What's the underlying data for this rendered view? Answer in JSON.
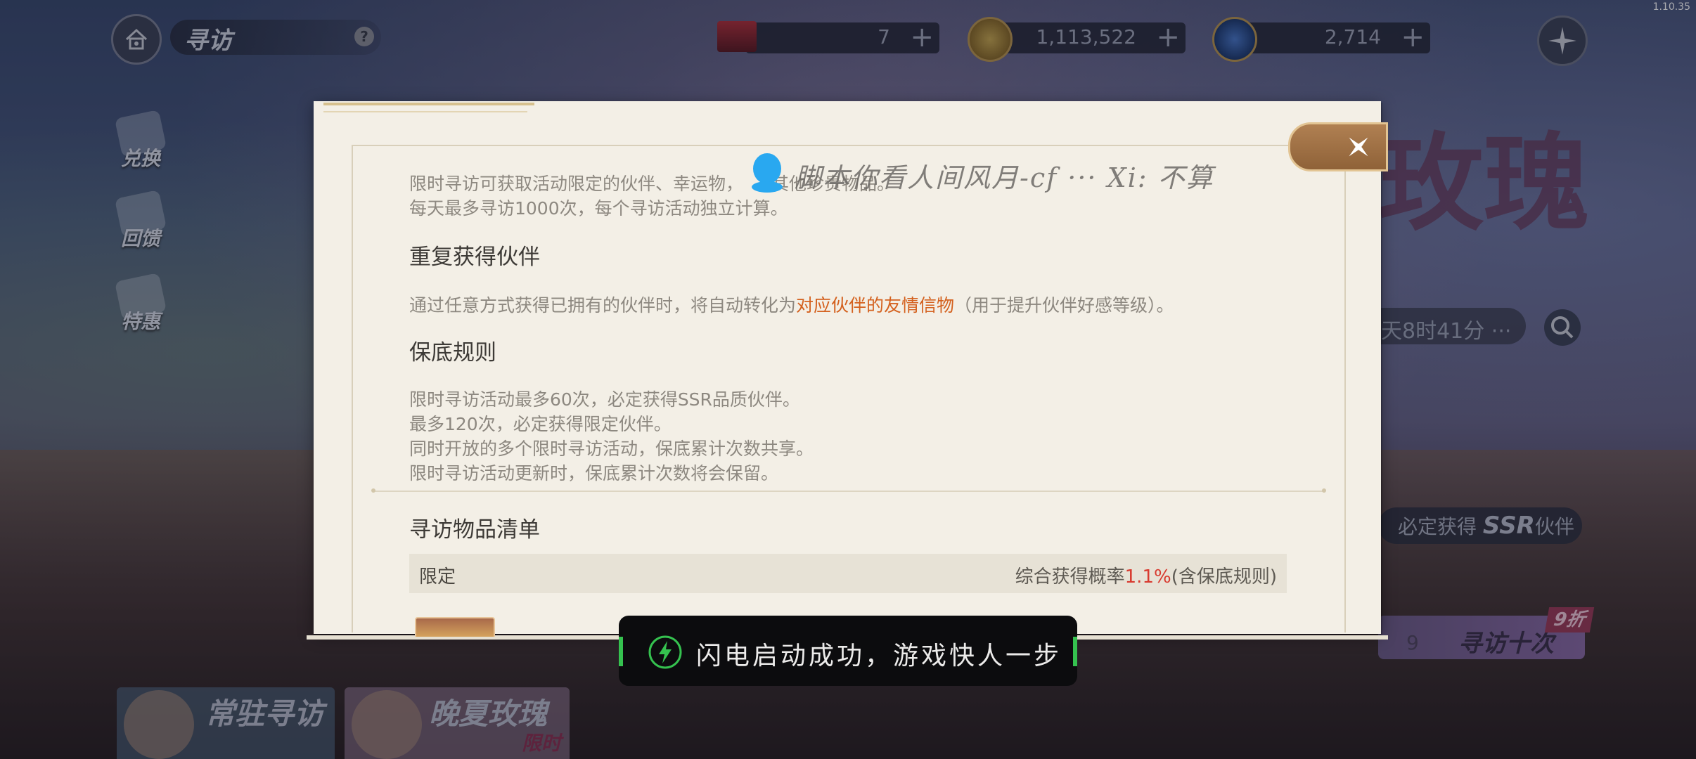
{
  "version": "1.10.35",
  "hud": {
    "title": "寻访",
    "help_label": "?",
    "resources": [
      {
        "icon": "ticket-icon",
        "value": "7",
        "add_label": "+"
      },
      {
        "icon": "gold-coin-icon",
        "value": "1,113,522",
        "add_label": "+"
      },
      {
        "icon": "gem-orb-icon",
        "value": "2,714",
        "add_label": "+"
      }
    ]
  },
  "side_menu": [
    {
      "icon": "scroll-icon",
      "label": "兑换"
    },
    {
      "icon": "gift-icon",
      "label": "回馈"
    },
    {
      "icon": "ticket-tag-icon",
      "label": "特惠"
    }
  ],
  "background": {
    "banner_title": "玫瑰",
    "timer_text": "天8时41分 ···",
    "guarantee_prefix": "必定获得",
    "guarantee_tier": "SSR",
    "guarantee_suffix": "伙伴",
    "ten_pull_count": "9",
    "ten_pull_label": "寻访十次",
    "discount_badge": "9折"
  },
  "bottom_tabs": [
    {
      "label": "常驻寻访",
      "tag": ""
    },
    {
      "label": "晚夏玫瑰",
      "tag": "限时"
    }
  ],
  "modal": {
    "intro_line1_a": "限时寻访可获取活动限定的伙伴、幸运物，",
    "intro_line1_b": "其他珍贵物品。",
    "intro_line2": "每天最多寻访1000次，每个寻访活动独立计算。",
    "section1_title": "重复获得伙伴",
    "section1_text_a": "通过任意方式获得已拥有的伙伴时，将自动转化为",
    "section1_text_highlight": "对应伙伴的友情信物",
    "section1_text_b": "（用于提升伙伴好感等级）。",
    "section2_title": "保底规则",
    "section2_lines": [
      "限时寻访活动最多60次，必定获得SSR品质伙伴。",
      "最多120次，必定获得限定伙伴。",
      "同时开放的多个限时寻访活动，保底累计次数共享。",
      "限时寻访活动更新时，保底累计次数将会保留。"
    ],
    "list_title": "寻访物品清单",
    "list_row_label": "限定",
    "list_row_rate_prefix": "综合获得概率",
    "list_row_rate_value": "1.1%",
    "list_row_rate_suffix": "(含保底规则)"
  },
  "watermark": "脚本你看人间风月-cf ···   Xi: 不算",
  "toast": {
    "text": "闪电启动成功，游戏快人一步"
  },
  "colors": {
    "modal_bg": "#f3efe6",
    "highlight_orange": "#d4611e",
    "highlight_red": "#d83a2f",
    "toast_accent": "#35c24f"
  }
}
